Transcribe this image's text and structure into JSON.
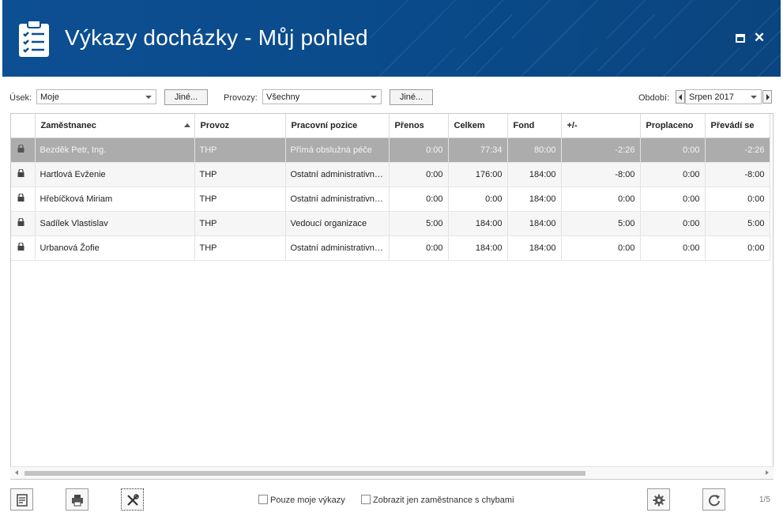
{
  "window": {
    "title": "Výkazy docházky - Můj pohled",
    "app_icon": "clipboard-checklist-icon",
    "maximize_icon": "maximize-icon",
    "close_icon": "close-icon",
    "close_glyph": "✕"
  },
  "filters": {
    "usek_label": "Úsek:",
    "usek_value": "Moje",
    "usek_other_button": "Jiné...",
    "provozy_label": "Provozy:",
    "provozy_value": "Všechny",
    "provozy_other_button": "Jiné...",
    "obdobi_label": "Období:",
    "obdobi_value": "Srpen 2017"
  },
  "table": {
    "columns": [
      "Zaměstnanec",
      "Provoz",
      "Pracovní pozice",
      "Přenos",
      "Celkem",
      "Fond",
      "+/-",
      "Proplaceno",
      "Převádí se"
    ],
    "sort_column": "Zaměstnanec",
    "rows": [
      {
        "locked": true,
        "selected": true,
        "employee": "Bezděk Petr, Ing.",
        "provoz": "THP",
        "position": "Přímá obslužná péče",
        "prenos": "0:00",
        "celkem": "77:34",
        "fond": "80:00",
        "diff": "-2:26",
        "proplaceno": "0:00",
        "prevadi": "-2:26"
      },
      {
        "locked": true,
        "selected": false,
        "employee": "Hartlová Evženie",
        "provoz": "THP",
        "position": "Ostatní administrativní pracovníci",
        "prenos": "0:00",
        "celkem": "176:00",
        "fond": "184:00",
        "diff": "-8:00",
        "proplaceno": "0:00",
        "prevadi": "-8:00"
      },
      {
        "locked": true,
        "selected": false,
        "employee": "Hřebíčková Miriam",
        "provoz": "THP",
        "position": "Ostatní administrativní pracovníci",
        "prenos": "0:00",
        "celkem": "0:00",
        "fond": "184:00",
        "diff": "0:00",
        "proplaceno": "0:00",
        "prevadi": "0:00"
      },
      {
        "locked": true,
        "selected": false,
        "employee": "Sadílek Vlastislav",
        "provoz": "THP",
        "position": "Vedoucí organizace",
        "prenos": "5:00",
        "celkem": "184:00",
        "fond": "184:00",
        "diff": "5:00",
        "proplaceno": "0:00",
        "prevadi": "5:00"
      },
      {
        "locked": true,
        "selected": false,
        "employee": "Urbanová Žofie",
        "provoz": "THP",
        "position": "Ostatní administrativní pracovníci",
        "prenos": "0:00",
        "celkem": "184:00",
        "fond": "184:00",
        "diff": "0:00",
        "proplaceno": "0:00",
        "prevadi": "0:00"
      }
    ]
  },
  "footer": {
    "buttons": [
      "report-icon",
      "print-icon",
      "tools-icon"
    ],
    "checkbox_own_reports": "Pouze moje výkazy",
    "checkbox_errors_only": "Zobrazit jen zaměstnance s chybami",
    "settings_icon": "gear-icon",
    "refresh_icon": "refresh-icon",
    "pager": "1/5"
  },
  "colors": {
    "header_bg": "#0c4f92",
    "selected_row": "#acacac"
  }
}
